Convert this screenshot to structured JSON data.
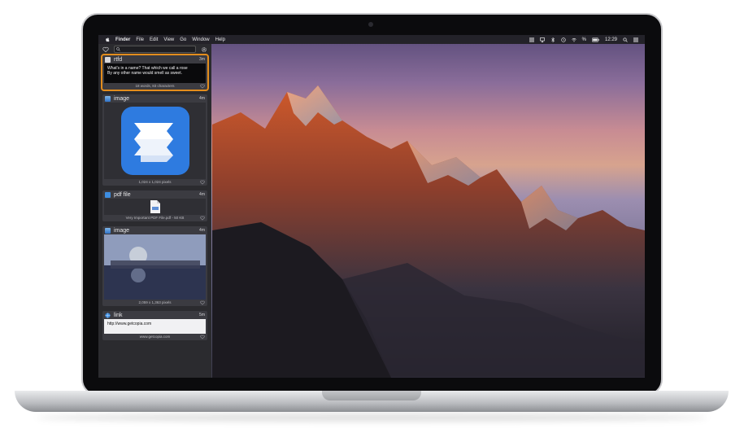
{
  "menubar": {
    "app": "Finder",
    "items": [
      "File",
      "Edit",
      "View",
      "Go",
      "Window",
      "Help"
    ],
    "battery": "%",
    "time": "12:29"
  },
  "clips": [
    {
      "type": "rtfd",
      "age": "3m",
      "text_line1": "What's in a name? That which we call a rose",
      "text_line2": "By any other name would smell as sweet.",
      "footer": "18 words, 83 characters",
      "selected": true
    },
    {
      "type": "image",
      "age": "4m",
      "footer": "1,024 x 1,024 pixels"
    },
    {
      "type": "pdf file",
      "age": "4m",
      "footer": "Very Important PDF File.pdf - 50 KB"
    },
    {
      "type": "image",
      "age": "4m",
      "footer": "2,059 x 1,363 pixels"
    },
    {
      "type": "link",
      "age": "5m",
      "url": "http://www.getcopia.com",
      "footer": "www.getcopia.com"
    }
  ],
  "colors": {
    "accent": "#e38d1d",
    "panel": "#2b2b2f"
  }
}
